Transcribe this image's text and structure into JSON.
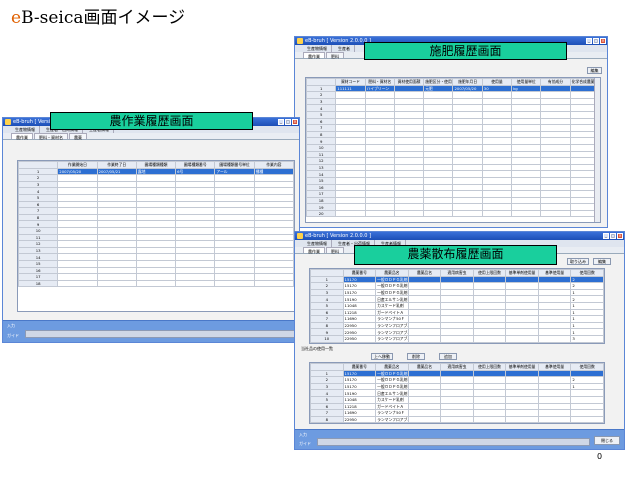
{
  "slide": {
    "title_prefix": "e",
    "title_rest": "B-seica画面イメージ",
    "page_number": "0"
  },
  "colors": {
    "banner": "#19cf9d",
    "title_bar": "#2a5fc9",
    "selected_row": "#2d6fd2",
    "status_bar": "#6d9be0",
    "title_e": "#e06000"
  },
  "fert": {
    "window_title": "eB-bruh [ Version 2.0.0.0 ]",
    "banner": "施肥履歴画面",
    "menu": [
      "生産物情報",
      "生産者"
    ],
    "tabs": [
      "農作業",
      "肥料"
    ],
    "btn_edit": "編集",
    "columns": [
      "資材コード",
      "肥料・資材名",
      "資材使用面積",
      "施肥区分・使用方法",
      "施肥年月日",
      "使用量",
      "使用量単位",
      "有効成分",
      "化学合成農薬等"
    ],
    "rows": [
      [
        "111111",
        "ハイブリーン",
        "",
        "元肥",
        "2007/05/20",
        "30",
        "kg",
        "",
        ""
      ]
    ]
  },
  "work": {
    "window_title": "eB-bruh [ Version 2.0.0.0 ]",
    "banner": "農作業履歴画面",
    "menu": [
      "生産物情報",
      "生産者・出荷情報",
      "生産者情報"
    ],
    "tabs": [
      "農作業",
      "肥料・資材名",
      "農薬"
    ],
    "columns": [
      "作業開始日",
      "作業終了日",
      "圃場種類種類",
      "圃場種類番号",
      "圃場種類番号単位",
      "作業内容"
    ],
    "rows": [
      [
        "2007/05/20",
        "2007/05/21",
        "露地",
        "6号",
        "アール",
        "播種"
      ]
    ],
    "status_input": "入力",
    "status_guide": "ガイド"
  },
  "pest": {
    "window_title": "eB-bruh [ Version 2.0.0.0 ]",
    "banner": "農薬散布履歴画面",
    "menu": [
      "生産物情報",
      "生産者・出荷情報",
      "生産者情報"
    ],
    "tabs": [
      "農作業",
      "肥料"
    ],
    "btn_import": "取り込み",
    "btn_edit": "編集",
    "columns": [
      "農薬番号",
      "農薬品名",
      "農薬品名",
      "適用病害虫",
      "使用上限回数",
      "基準単剤使用量",
      "基準使用量",
      "使用回数"
    ],
    "rows": [
      [
        "15170",
        "一般ＯＤＰＧ乳剤5.0",
        "",
        "",
        "",
        "",
        "",
        "2"
      ],
      [
        "15170",
        "一般ＯＤＰＧ乳剤5.0",
        "",
        "",
        "",
        "",
        "",
        "2"
      ],
      [
        "15170",
        "一般ＯＤＰＧ乳剤5.0",
        "",
        "",
        "",
        "",
        "",
        "1"
      ],
      [
        "15190",
        "日産エルサン乳剤",
        "",
        "",
        "",
        "",
        "",
        "2"
      ],
      [
        "11048",
        "カスケード乳剤",
        "",
        "",
        "",
        "",
        "",
        "1"
      ],
      [
        "11218",
        "ガードベイトＡ",
        "",
        "",
        "",
        "",
        "",
        "1"
      ],
      [
        "11690",
        "ランマンナ50Ｆ",
        "",
        "",
        "",
        "",
        "",
        "1"
      ],
      [
        "22950",
        "ランマンフロアブル",
        "",
        "",
        "",
        "",
        "",
        "1"
      ],
      [
        "22950",
        "ランマンフロアブル",
        "",
        "",
        "",
        "",
        "",
        "1"
      ],
      [
        "22950",
        "ランマンフロアブル",
        "",
        "",
        "",
        "",
        "",
        "3"
      ]
    ],
    "sub_label": "当社品の使用一覧",
    "btn_up": "上へ移動",
    "btn_del": "削除",
    "btn_add": "追加",
    "sub_rows": [
      [
        "15170",
        "一般ＯＤＰＧ乳剤5.0",
        "",
        "",
        "",
        "",
        "",
        ""
      ],
      [
        "15170",
        "一般ＯＤＰＧ乳剤5.0",
        "",
        "",
        "",
        "",
        "",
        "2"
      ],
      [
        "15170",
        "一般ＯＤＰＧ乳剤5.0",
        "",
        "",
        "",
        "",
        "",
        "1"
      ],
      [
        "15190",
        "日産エルサン乳剤",
        "",
        "",
        "",
        "",
        "",
        ""
      ],
      [
        "11048",
        "カスケード乳剤",
        "",
        "",
        "",
        "",
        "",
        ""
      ],
      [
        "11218",
        "ガードベイトＡ",
        "",
        "",
        "",
        "",
        "",
        ""
      ],
      [
        "11690",
        "ランマンナ50Ｆ",
        "",
        "",
        "",
        "",
        "",
        ""
      ],
      [
        "22950",
        "ランマンフロアブル",
        "",
        "",
        "",
        "",
        "",
        ""
      ]
    ],
    "status_input": "入力",
    "status_guide": "ガイド",
    "btn_close": "閉じる"
  }
}
